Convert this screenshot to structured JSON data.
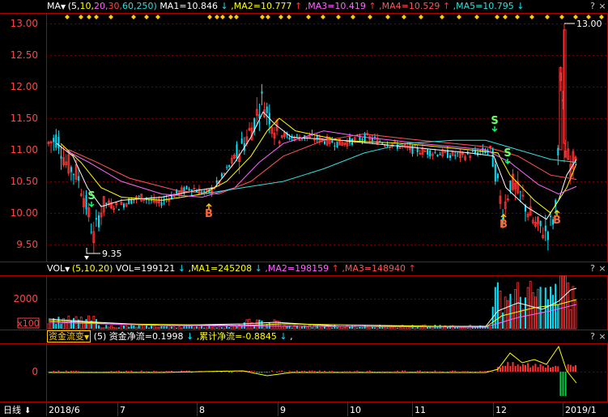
{
  "colors": {
    "up": "#ff3333",
    "down": "#00e5ff",
    "ma1": "#ffffff",
    "ma2": "#ffff00",
    "ma3": "#ff66ff",
    "ma4": "#ff5555",
    "ma5": "#33dddd",
    "grid": "#7a0000",
    "axis": "#b00000",
    "text": "#dddddd",
    "diamond": "#ffcc00"
  },
  "price_panel": {
    "indicator": "MA",
    "params_prefix": "(5,",
    "params": [
      "10,",
      "20,",
      "30,",
      "60,",
      "250)"
    ],
    "params_colors": [
      "#ffff00",
      "#ff66ff",
      "#ff4444",
      "#33dddd",
      "#33dddd"
    ],
    "ma_values": [
      {
        "label": "MA1=10.846",
        "arrow": "↓",
        "color": "#ffffff",
        "arrow_color": "#00e5ff"
      },
      {
        "label": ",MA2=10.777",
        "arrow": "↑",
        "color": "#ffff00",
        "arrow_color": "#ff3333"
      },
      {
        "label": ",MA3=10.419",
        "arrow": "↑",
        "color": "#ff66ff",
        "arrow_color": "#ff3333"
      },
      {
        "label": ",MA4=10.529",
        "arrow": "↑",
        "color": "#ff5555",
        "arrow_color": "#ff3333"
      },
      {
        "label": ",MA5=10.795",
        "arrow": "↓",
        "color": "#33dddd",
        "arrow_color": "#00e5ff"
      }
    ],
    "y_ticks": [
      "13.00",
      "12.50",
      "12.00",
      "11.50",
      "11.00",
      "10.50",
      "10.00",
      "9.50"
    ],
    "high_label": "13.00",
    "low_label": "9.35",
    "signals": [
      {
        "text": "S",
        "kind": "sell"
      },
      {
        "text": "S",
        "kind": "sell"
      },
      {
        "text": "S",
        "kind": "sell"
      },
      {
        "text": "B",
        "kind": "buy"
      },
      {
        "text": "B",
        "kind": "buy"
      },
      {
        "text": "B",
        "kind": "buy"
      }
    ]
  },
  "volume_panel": {
    "indicator": "VOL",
    "params": "(5,10,20)",
    "values": [
      {
        "label": "VOL=199121",
        "arrow": "↓",
        "color": "#ffffff",
        "arrow_color": "#00e5ff"
      },
      {
        "label": ",MA1=245208",
        "arrow": "↓",
        "color": "#ffff00",
        "arrow_color": "#00e5ff"
      },
      {
        "label": ",MA2=198159",
        "arrow": "↑",
        "color": "#ff66ff",
        "arrow_color": "#ff3333"
      },
      {
        "label": ",MA3=148940",
        "arrow": "↑",
        "color": "#ff5555",
        "arrow_color": "#ff3333"
      }
    ],
    "y_tick": "2000",
    "unit": "x100"
  },
  "flow_panel": {
    "indicator": "资金流变",
    "param": "(5)",
    "values": [
      {
        "label": "资金净流=0.1998",
        "arrow": "↓",
        "color": "#ffffff",
        "arrow_color": "#00e5ff"
      },
      {
        "label": ",累计净流=-0.8845",
        "arrow": "↓",
        "color": "#ffff00",
        "arrow_color": "#00e5ff"
      },
      {
        "label": ",",
        "arrow": "",
        "color": "#ffffff",
        "arrow_color": "#ffffff"
      }
    ],
    "y_tick": "0"
  },
  "controls": [
    "?",
    "×"
  ],
  "bottom_bar": {
    "period": "日线",
    "period_arrow": "⬇",
    "dates": [
      "2018/6",
      "7",
      "8",
      "9",
      "10",
      "11",
      "12",
      "2019/1"
    ]
  }
}
